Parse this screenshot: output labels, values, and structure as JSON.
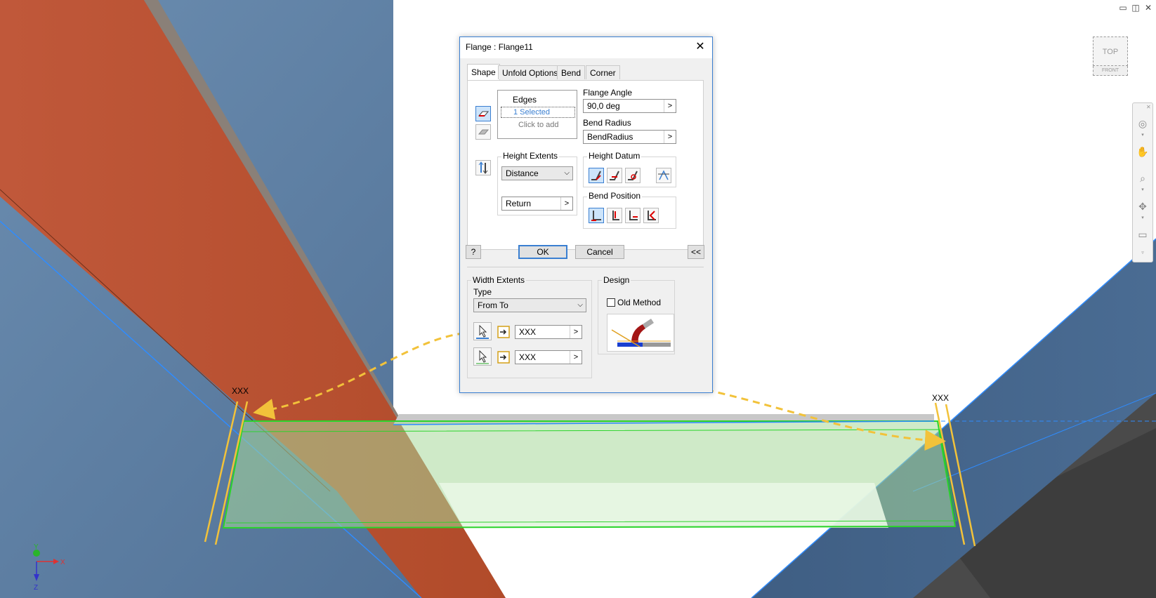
{
  "window_controls": {
    "minimize": "▭",
    "restore": "◫",
    "close": "✕"
  },
  "viewport": {
    "viewcube": {
      "top": "TOP",
      "front": "FRONT"
    },
    "annotations": {
      "left_marker": "XXX",
      "right_marker": "XXX"
    },
    "axes": {
      "x": "X",
      "y": "Y",
      "z": "Z"
    },
    "nav_icons": [
      "steering-wheel-icon",
      "pan-hand-icon",
      "zoom-icon",
      "orbit-icon",
      "look-at-icon"
    ]
  },
  "colors": {
    "accent_blue": "#3a7fd1",
    "orange_beam": "#b85230",
    "blue_beam": "#5a7ea3",
    "flange_green": "#2ad42a",
    "annotation_yellow": "#f2c23a",
    "dark_metal": "#4a4a4a"
  },
  "dialog": {
    "title": "Flange : Flange11",
    "close_label": "✕",
    "tabs": [
      {
        "label": "Shape",
        "active": true
      },
      {
        "label": "Unfold Options",
        "active": false
      },
      {
        "label": "Bend",
        "active": false
      },
      {
        "label": "Corner",
        "active": false
      }
    ],
    "edges": {
      "header": "Edges",
      "selected": "1 Selected",
      "click_to_add": "Click to add"
    },
    "flange_angle": {
      "label": "Flange Angle",
      "value": "90,0 deg",
      "arrow": ">"
    },
    "bend_radius": {
      "label": "Bend Radius",
      "value": "BendRadius",
      "arrow": ">"
    },
    "height_extents": {
      "label": "Height Extents",
      "type_value": "Distance",
      "distance_value": "Return",
      "arrow": ">"
    },
    "height_datum": {
      "label": "Height Datum"
    },
    "bend_position": {
      "label": "Bend Position"
    },
    "buttons": {
      "ok": "OK",
      "cancel": "Cancel",
      "collapse": "<<",
      "help": "?"
    },
    "width_extents": {
      "label": "Width Extents",
      "type_label": "Type",
      "type_value": "From To",
      "from_value": "XXX",
      "to_value": "XXX",
      "arrow": ">"
    },
    "design": {
      "label": "Design",
      "old_method": "Old Method",
      "old_method_checked": false
    }
  }
}
